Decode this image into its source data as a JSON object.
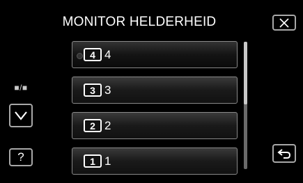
{
  "header": {
    "title": "MONITOR HELDERHEID"
  },
  "sidebar": {
    "toggle_label": "■/■",
    "help_label": "?"
  },
  "brightness": {
    "selected_value": "4",
    "options": [
      {
        "badge": "4",
        "label": "4"
      },
      {
        "badge": "3",
        "label": "3"
      },
      {
        "badge": "2",
        "label": "2"
      },
      {
        "badge": "1",
        "label": "1"
      }
    ]
  },
  "icons": {
    "close": "close-icon",
    "down": "chevron-down-icon",
    "back": "back-arrow-icon"
  }
}
